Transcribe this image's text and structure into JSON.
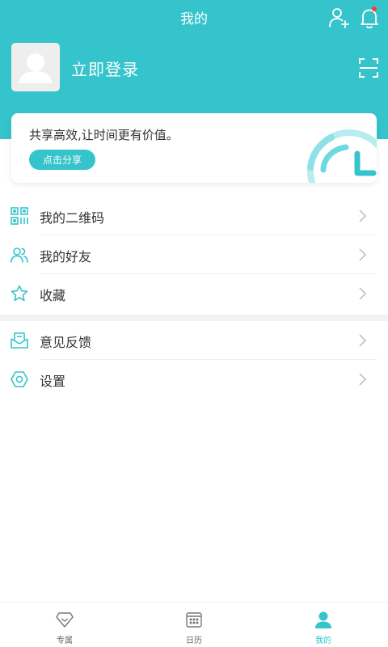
{
  "header": {
    "title": "我的",
    "login_text": "立即登录"
  },
  "share_card": {
    "text": "共享高效,让时间更有价值。",
    "button_label": "点击分享"
  },
  "menu_group_1": [
    {
      "label": "我的二维码"
    },
    {
      "label": "我的好友"
    },
    {
      "label": "收藏"
    }
  ],
  "menu_group_2": [
    {
      "label": "意见反馈"
    },
    {
      "label": "设置"
    }
  ],
  "tabs": [
    {
      "label": "专属"
    },
    {
      "label": "日历"
    },
    {
      "label": "我的"
    }
  ],
  "colors": {
    "accent": "#35c4cc",
    "notification_dot": "#ff3b30"
  }
}
